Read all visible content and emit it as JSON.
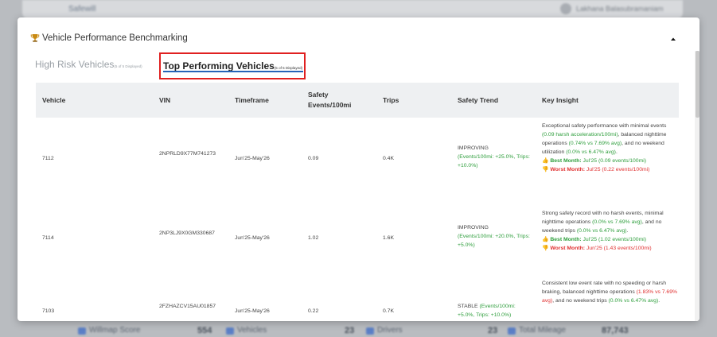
{
  "backdrop": {
    "logo_text": "Safewill",
    "user_name": "Lakhana Balasubramaniam",
    "stats": [
      {
        "label": "Willmap Score",
        "value": "554"
      },
      {
        "label": "Vehicles",
        "value": "23"
      },
      {
        "label": "Drivers",
        "value": "23"
      },
      {
        "label": "Total Mileage",
        "value": "87,743"
      }
    ]
  },
  "modal": {
    "title": "Vehicle Performance Benchmarking",
    "icons": {
      "title_icon": "trophy-icon",
      "collapse_icon": "caret-up-icon"
    },
    "tabs": [
      {
        "label": "High Risk Vehicles",
        "sub": "(5 of 5 Displayed)",
        "active": false
      },
      {
        "label": "Top Performing Vehicles",
        "sub": "(5 of 5 Displayed)",
        "active": true
      }
    ],
    "columns": [
      "Vehicle",
      "VIN",
      "Timeframe",
      "Safety Events/100mi",
      "Trips",
      "Safety Trend",
      "Key Insight"
    ],
    "rows": [
      {
        "vehicle": "7112",
        "vin": "2NPRLD9X77M741273",
        "timeframe": "Jun'25-May'26",
        "safety_events": "0.09",
        "trips": "0.4K",
        "trend_label": "IMPROVING",
        "trend_detail": "(Events/100mi: +25.0%, Trips: +10.0%)",
        "insight_a": "Exceptional safety performance with minimal events ",
        "insight_b": "(0.09 harsh acceleration/100mi)",
        "insight_c": ", balanced nighttime operations ",
        "insight_d": "(0.74% vs 7.69% avg)",
        "insight_e": ", and no weekend utilization ",
        "insight_f": "(0.0% vs 6.47% avg)",
        "insight_g": ".",
        "best_label": "Best Month:",
        "best_value": "Jul'25 (0.09 events/100mi)",
        "worst_label": "Worst Month:",
        "worst_value": "Jul'25 (0.22 events/100mi)"
      },
      {
        "vehicle": "7114",
        "vin": "2NP3LJ9X0GM330687",
        "timeframe": "Jun'25-May'26",
        "safety_events": "1.02",
        "trips": "1.6K",
        "trend_label": "IMPROVING",
        "trend_detail": "(Events/100mi: +20.0%, Trips: +5.0%)",
        "insight_a": "Strong safety record with no harsh events, minimal nighttime operations ",
        "insight_b": "(0.0% vs 7.69% avg)",
        "insight_c": ", and no weekend trips ",
        "insight_d": "(0.0% vs 6.47% avg)",
        "insight_e": ".",
        "best_label": "Best Month:",
        "best_value": "Jul'25 (1.02 events/100mi)",
        "worst_label": "Worst Month:",
        "worst_value": "Jun'25 (1.43 events/100mi)"
      },
      {
        "vehicle": "7103",
        "vin": "2FZHAZCV15AU01857",
        "timeframe": "Jun'25-May'26",
        "safety_events": "0.22",
        "trips": "0.7K",
        "trend_label": "STABLE",
        "trend_detail": "(Events/100mi: +5.0%, Trips: +10.0%)",
        "insight_a": "Consistent low event rate with no speeding or harsh braking, balanced nighttime operations ",
        "insight_b": "(1.83% vs 7.69% avg)",
        "insight_c": ", and no weekend trips ",
        "insight_d": "(0.0% vs 6.47% avg)",
        "insight_e": "."
      }
    ]
  }
}
